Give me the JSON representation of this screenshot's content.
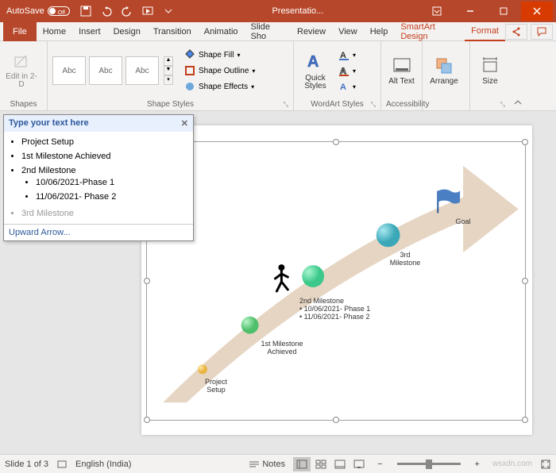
{
  "titlebar": {
    "autosave_label": "AutoSave",
    "autosave_state": "Off",
    "doc_title": "Presentatio..."
  },
  "tabs": {
    "file": "File",
    "home": "Home",
    "insert": "Insert",
    "design": "Design",
    "transitions": "Transition",
    "animations": "Animatio",
    "slideshow": "Slide Sho",
    "review": "Review",
    "view": "View",
    "help": "Help",
    "smartart": "SmartArt Design",
    "format": "Format"
  },
  "ribbon": {
    "edit2d": "Edit in 2-D",
    "shapes_label": "Shapes",
    "abc": "Abc",
    "shape_styles_label": "Shape Styles",
    "shape_fill": "Shape Fill",
    "shape_outline": "Shape Outline",
    "shape_effects": "Shape Effects",
    "quick_styles": "Quick Styles",
    "wordart_label": "WordArt Styles",
    "alt_text": "Alt Text",
    "accessibility_label": "Accessibility",
    "arrange": "Arrange",
    "size": "Size"
  },
  "textpane": {
    "header": "Type your text here",
    "items": [
      "Project Setup",
      "1st Milestone Achieved",
      "2nd Milestone",
      "3rd Milestone"
    ],
    "subitems": [
      "10/06/2021-Phase  1",
      "11/06/2021-  Phase 2"
    ],
    "footer": "Upward Arrow..."
  },
  "diagram": {
    "m1": "Project Setup",
    "m2a": "1st Milestone",
    "m2b": "Achieved",
    "m3": "2nd Milestone",
    "m3_b1": "10/06/2021- Phase 1",
    "m3_b2": "11/06/2021- Phase 2",
    "m4a": "3rd",
    "m4b": "Milestone",
    "goal": "Goal"
  },
  "statusbar": {
    "slide": "Slide 1 of 3",
    "lang": "English (India)",
    "notes": "Notes",
    "watermark": "wsxdn.com"
  }
}
